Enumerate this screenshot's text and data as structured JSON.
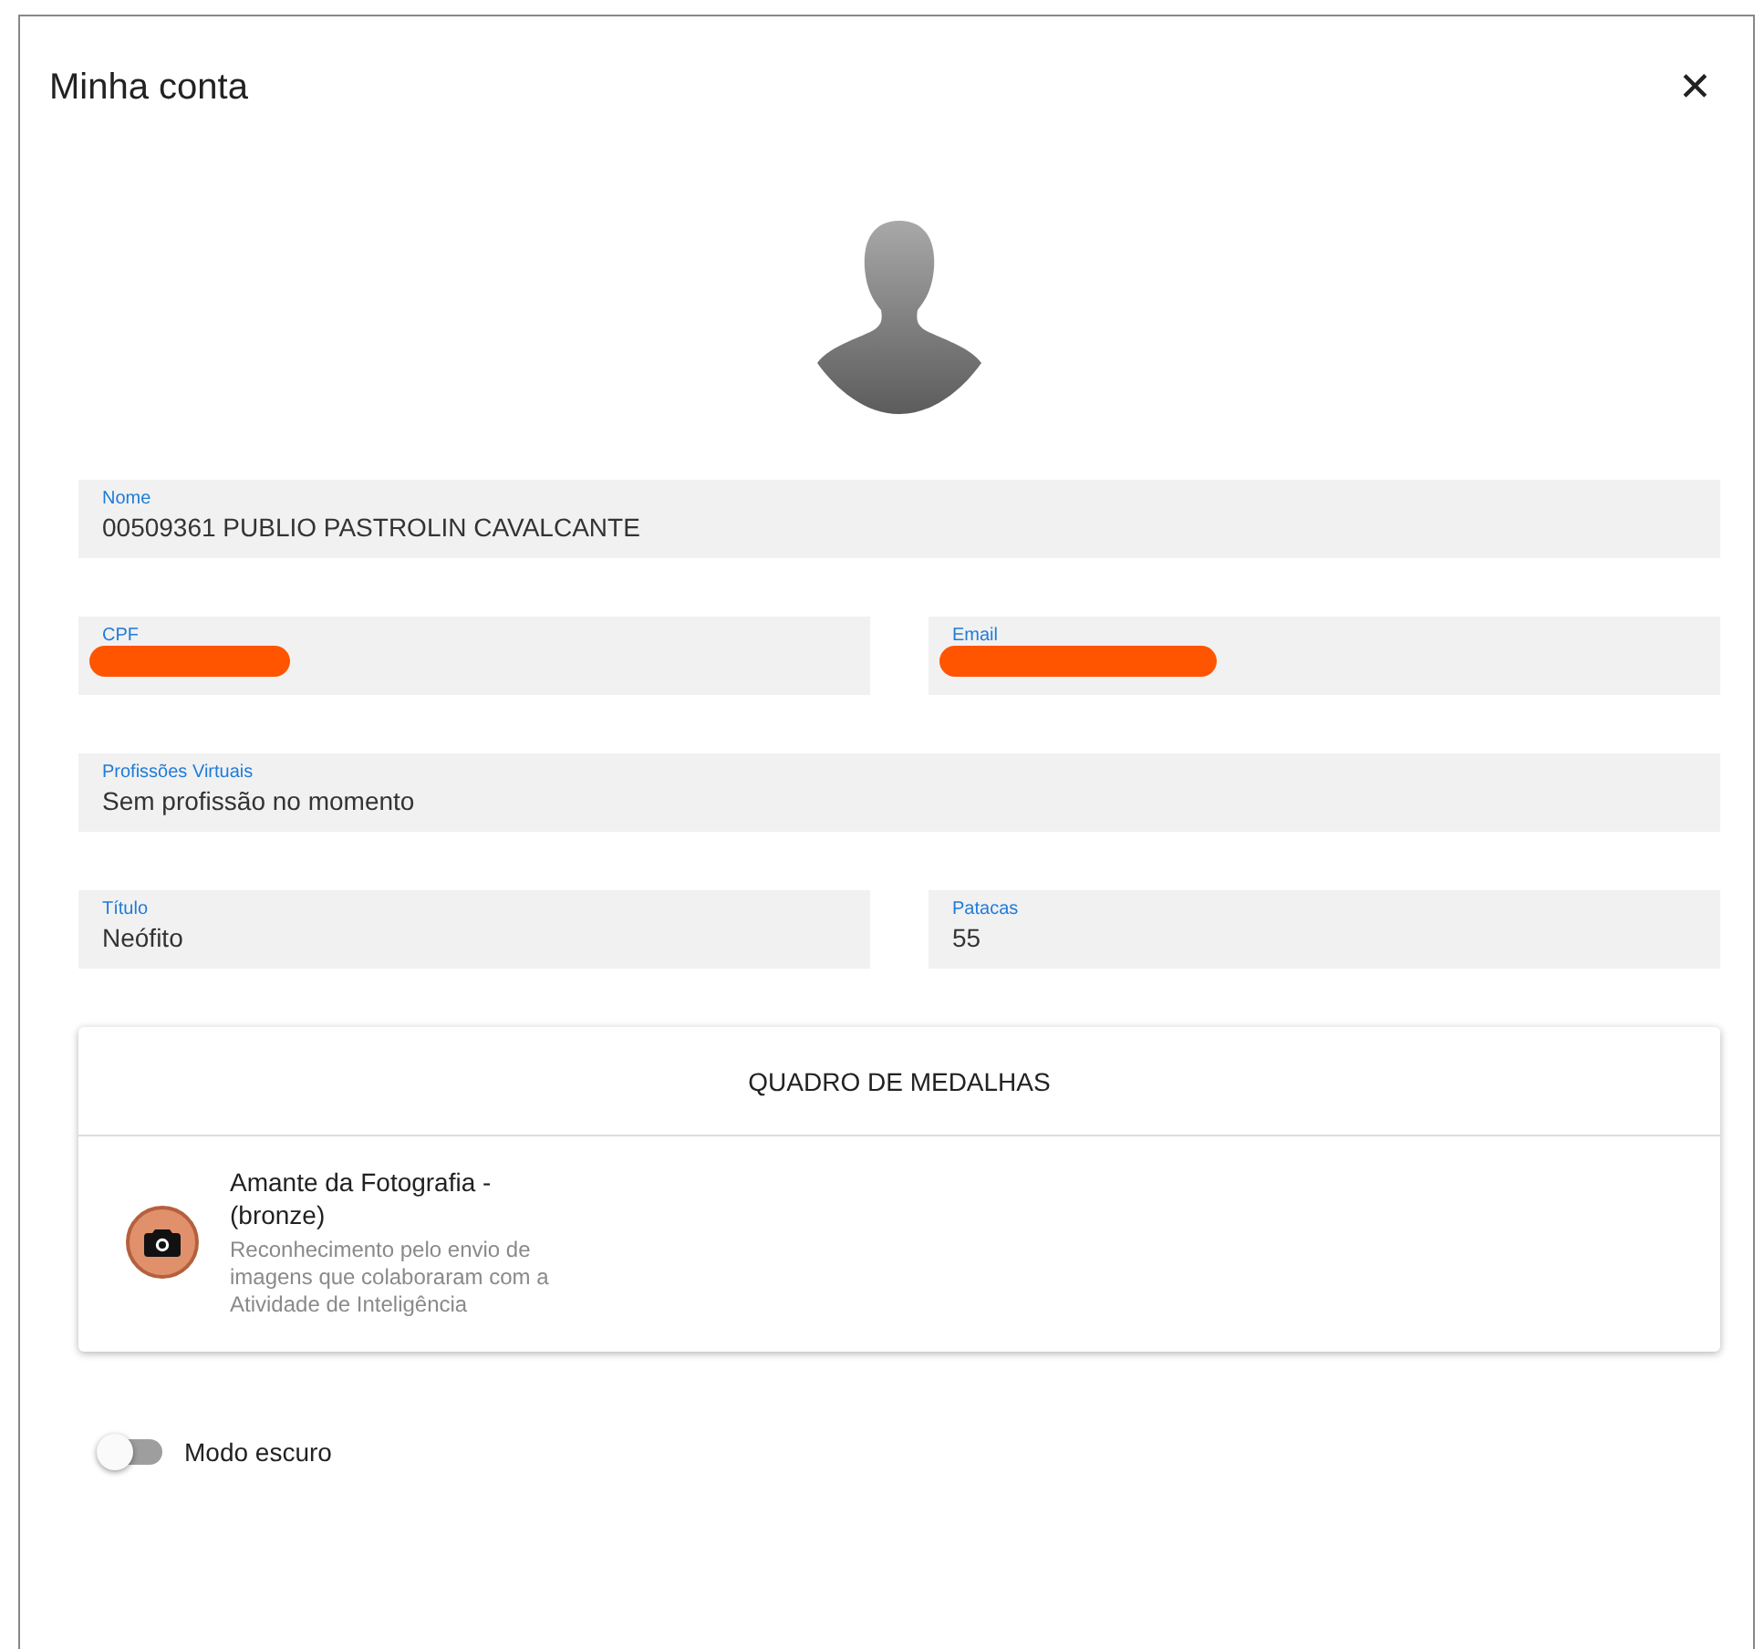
{
  "dialog": {
    "title": "Minha conta",
    "close": "✕"
  },
  "fields": [
    {
      "kind": "wide",
      "label": "Nome",
      "value": "00509361 PUBLIO PASTROLIN CAVALCANTE",
      "redacted": false
    },
    {
      "kind": "half",
      "label": "CPF",
      "redacted": true
    },
    {
      "kind": "half",
      "label": "Email",
      "redacted": true
    },
    {
      "kind": "wide",
      "label": "Profissões Virtuais",
      "value": "Sem profissão no momento",
      "redacted": false
    },
    {
      "kind": "half",
      "label": "Título",
      "value": "Neófito",
      "redacted": false
    },
    {
      "kind": "half",
      "label": "Patacas",
      "value": "55",
      "redacted": false
    }
  ],
  "medals": {
    "title": "QUADRO DE MEDALHAS",
    "items": [
      {
        "name": "Amante da Fotografia - (bronze)",
        "description": "Reconhecimento pelo envio de imagens que colaboraram com a Atividade de Inteligência",
        "color": "#e0916b"
      }
    ]
  },
  "dark_mode": {
    "label": "Modo escuro",
    "on": false
  }
}
